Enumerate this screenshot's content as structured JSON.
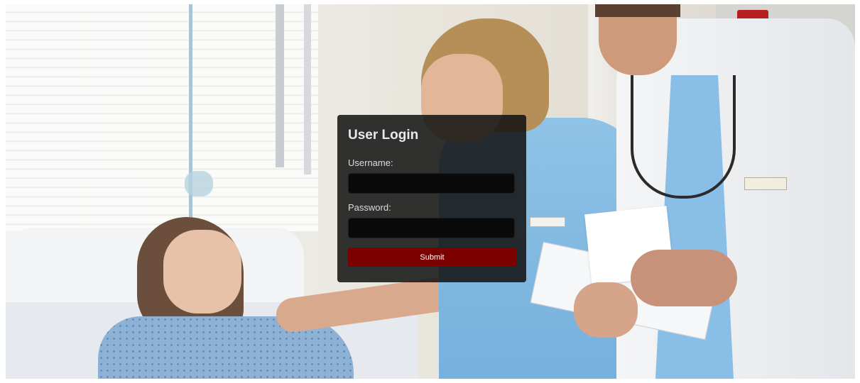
{
  "login": {
    "title": "User Login",
    "username_label": "Username:",
    "username_value": "",
    "password_label": "Password:",
    "password_value": "",
    "submit_label": "Submit"
  },
  "colors": {
    "panel_background": "#121212",
    "input_background": "#0a0a0a",
    "submit_button": "#7b0000",
    "text": "#e9e9e9"
  }
}
